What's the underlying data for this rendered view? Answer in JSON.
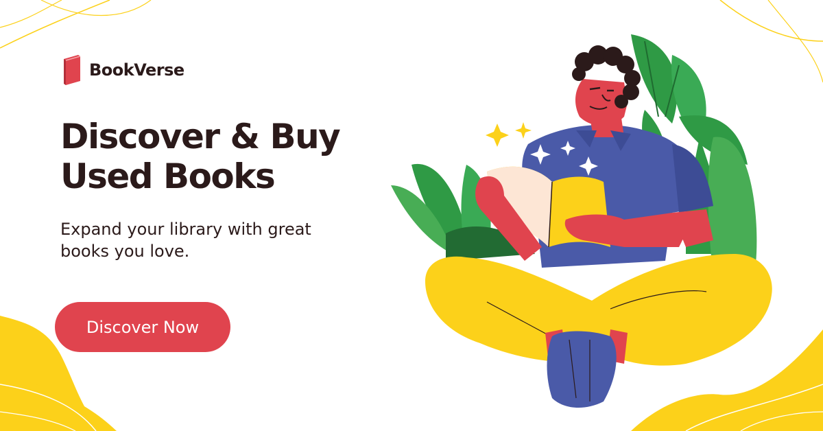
{
  "brand": {
    "name": "BookVerse",
    "icon": "book-icon"
  },
  "hero": {
    "headline": "Discover & Buy Used Books",
    "subtext": "Expand your library with great books you love.",
    "cta_label": "Discover Now"
  },
  "colors": {
    "accent": "#e0444e",
    "yellow": "#fcd11a",
    "text": "#2b1a1a",
    "shirt": "#4a5aa8",
    "skin": "#e0444e",
    "leaf": "#2f9a45"
  }
}
